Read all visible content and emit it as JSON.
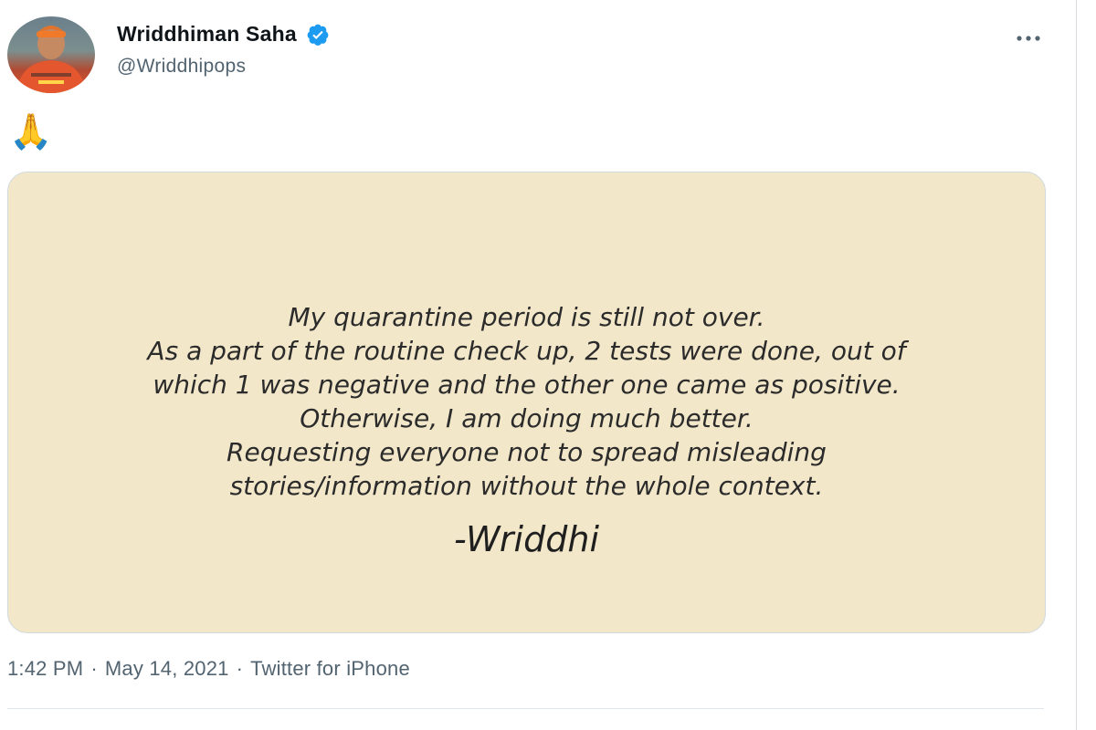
{
  "tweet": {
    "author": {
      "display_name": "Wriddhiman Saha",
      "handle": "@Wriddhipops",
      "verified": true,
      "avatar_icon": "profile-photo"
    },
    "more_icon": "more-horizontal-icon",
    "emoji": "🙏",
    "media": {
      "background_color": "#f3e7c9",
      "lines": [
        "My quarantine period is still not over.",
        "As a part of the routine check up, 2 tests were done, out of",
        "which 1 was negative and the other one came as positive.",
        "Otherwise, I am doing much better.",
        "Requesting everyone not to spread misleading",
        "stories/information without the whole context."
      ],
      "signature": "-Wriddhi"
    },
    "meta": {
      "time": "1:42 PM",
      "separator": "·",
      "date": "May 14, 2021",
      "source": "Twitter for iPhone"
    }
  },
  "colors": {
    "verified_badge": "#1d9bf0",
    "secondary_text": "#536471",
    "primary_text": "#0f1419"
  }
}
